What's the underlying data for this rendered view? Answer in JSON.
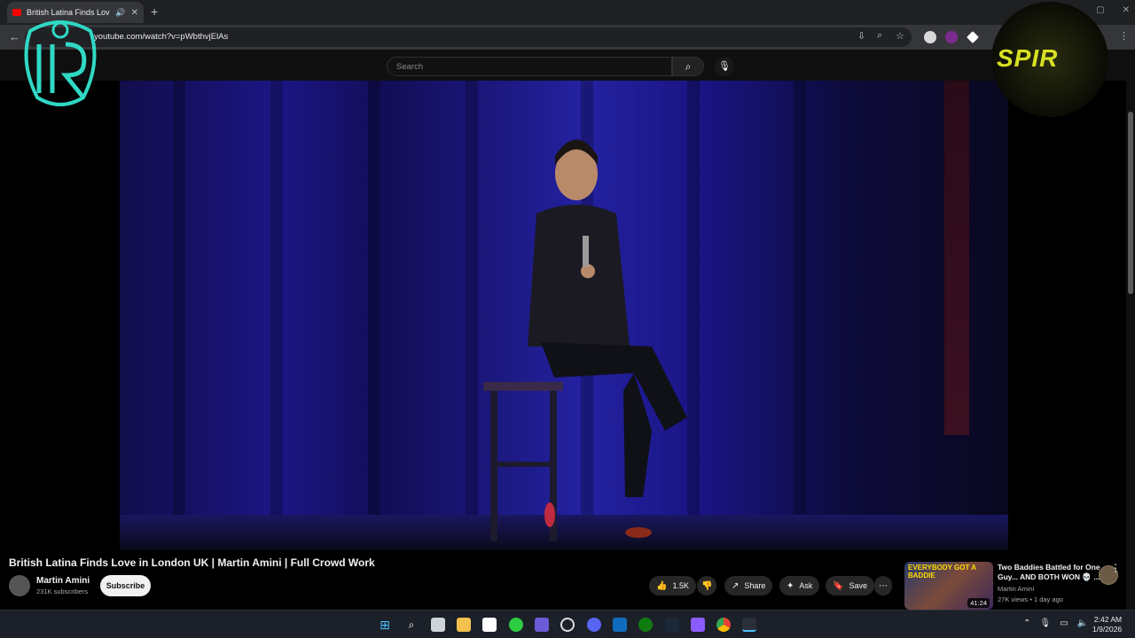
{
  "browser": {
    "tab_title": "British Latina Finds Love in London UK | Martin Amini | Full Crowd Work",
    "tab_title_display": "British Latina Finds Love in",
    "url": "youtube.com/watch?v=pWbthvjElAs",
    "new_tab_label": "+",
    "close_tab_label": "✕",
    "back_label": "←"
  },
  "youtube": {
    "search_placeholder": "Search",
    "video": {
      "title": "British Latina Finds Love in London UK | Martin Amini | Full Crowd Work",
      "channel": "Martin Amini",
      "subscribers": "231K subscribers",
      "subscribe_label": "Subscribe",
      "likes": "1.5K",
      "share_label": "Share",
      "ask_label": "Ask",
      "save_label": "Save"
    },
    "recommendation": {
      "thumb_caption": "EVERYBODY GOT A BADDIE",
      "duration": "41:24",
      "title": "Two Baddies Battled for One Guy... AND BOTH WON 💀 ...",
      "channel": "Martin Amini",
      "meta": "27K views • 1 day ago"
    }
  },
  "overlays": {
    "right_logo_text": "SPIR"
  },
  "taskbar": {
    "time": "2:42 AM",
    "date": "1/9/2026"
  },
  "colors": {
    "accent_red": "#ff0000",
    "logo_teal": "#2fd9c4",
    "logo_yellow": "#d7e022"
  }
}
